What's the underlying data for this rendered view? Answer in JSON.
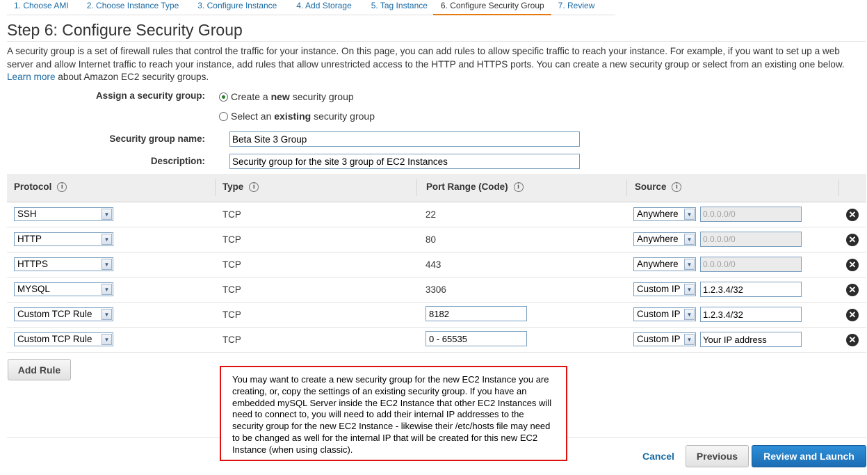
{
  "wizard": {
    "tabs": [
      {
        "label": "1. Choose AMI"
      },
      {
        "label": "2. Choose Instance Type"
      },
      {
        "label": "3. Configure Instance"
      },
      {
        "label": "4. Add Storage"
      },
      {
        "label": "5. Tag Instance"
      },
      {
        "label": "6. Configure Security Group"
      },
      {
        "label": "7. Review"
      }
    ],
    "active_tab": "6. Configure Security Group"
  },
  "page": {
    "title": "Step 6: Configure Security Group",
    "intro": "A security group is a set of firewall rules that control the traffic for your instance. On this page, you can add rules to allow specific traffic to reach your instance. For example, if you want to set up a web server and allow Internet traffic to reach your instance, add rules that allow unrestricted access to the HTTP and HTTPS ports. You can create a new security group or select from an existing one below.",
    "learn_more": "Learn more",
    "intro_suffix": "about Amazon EC2 security groups."
  },
  "form": {
    "assign_label": "Assign a security group:",
    "option_create_pre": "Create a",
    "option_create_bold": "new",
    "option_create_post": "security group",
    "option_existing_pre": "Select an",
    "option_existing_bold": "existing",
    "option_existing_post": "security group",
    "selected_option": "create",
    "name_label": "Security group name:",
    "name_value": "Beta Site 3 Group",
    "description_label": "Description:",
    "description_value": "Security group for the site 3 group of EC2 Instances"
  },
  "table": {
    "headers": {
      "protocol": "Protocol",
      "type": "Type",
      "port_range": "Port Range (Code)",
      "source": "Source"
    },
    "info_glyph": "i",
    "rows": [
      {
        "protocol": "SSH",
        "type": "TCP",
        "port": "22",
        "port_editable": false,
        "source": "Anywhere",
        "ip": "0.0.0.0/0",
        "ip_disabled": true
      },
      {
        "protocol": "HTTP",
        "type": "TCP",
        "port": "80",
        "port_editable": false,
        "source": "Anywhere",
        "ip": "0.0.0.0/0",
        "ip_disabled": true
      },
      {
        "protocol": "HTTPS",
        "type": "TCP",
        "port": "443",
        "port_editable": false,
        "source": "Anywhere",
        "ip": "0.0.0.0/0",
        "ip_disabled": true
      },
      {
        "protocol": "MYSQL",
        "type": "TCP",
        "port": "3306",
        "port_editable": false,
        "source": "Custom IP",
        "ip": "1.2.3.4/32",
        "ip_disabled": false
      },
      {
        "protocol": "Custom TCP Rule",
        "type": "TCP",
        "port": "8182",
        "port_editable": true,
        "source": "Custom IP",
        "ip": "1.2.3.4/32",
        "ip_disabled": false
      },
      {
        "protocol": "Custom TCP Rule",
        "type": "TCP",
        "port": "0 - 65535",
        "port_editable": true,
        "source": "Custom IP",
        "ip": "Your IP address",
        "ip_disabled": false
      }
    ],
    "remove_glyph": "✕"
  },
  "actions": {
    "add_rule": "Add Rule",
    "cancel": "Cancel",
    "previous": "Previous",
    "review_launch": "Review and Launch"
  },
  "note": {
    "text": "You may want to create a new security group for the new EC2 Instance you are creating, or, copy the settings of an existing security group.  If you have an embedded mySQL Server inside the EC2 Instance that other EC2 Instances will need to connect to, you will need to add their internal IP addresses to the security group for the new EC2 Instance - likewise their /etc/hosts file may need to be changed as well for the internal IP that will be created for this new EC2 Instance (when using classic)."
  },
  "colors": {
    "link": "#1a6aa4",
    "active_tab_underline": "#e47911",
    "primary_button": "#1c6db4",
    "note_border": "#e0100e"
  }
}
